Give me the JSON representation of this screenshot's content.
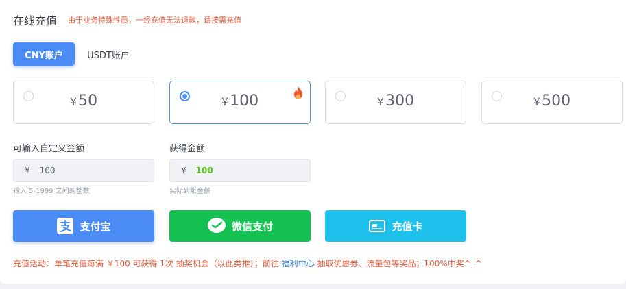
{
  "header": {
    "title": "在线充值",
    "notice": "由于业务特殊性质，一经充值无法退款，请按需充值"
  },
  "tabs": [
    {
      "label": "CNY账户",
      "active": true
    },
    {
      "label": "USDT账户",
      "active": false
    }
  ],
  "currency_symbol": "¥",
  "amounts": [
    {
      "value": "50",
      "selected": false,
      "hot": false
    },
    {
      "value": "100",
      "selected": true,
      "hot": true
    },
    {
      "value": "300",
      "selected": false,
      "hot": false
    },
    {
      "value": "500",
      "selected": false,
      "hot": false
    }
  ],
  "custom": {
    "label": "可输入自定义金额",
    "value": "100",
    "hint": "输入 5-1999 之间的整数"
  },
  "received": {
    "label": "获得金额",
    "value": "100",
    "hint": "实际到账金额"
  },
  "payment": {
    "alipay": "支付宝",
    "wechat": "微信支付",
    "card": "充值卡"
  },
  "promo": {
    "text_before": "充值活动：单笔充值每满 ￥100 可获得 1次 抽奖机会（以此类推）；前往 ",
    "link": "福利中心",
    "text_after": " 抽取优惠券、流量包等奖品；100%中奖^_^"
  },
  "colors": {
    "accent": "#4a8bf5",
    "wechat": "#14c152",
    "card": "#1ec0ec",
    "warning": "#e05a3a",
    "success": "#52c41a"
  }
}
